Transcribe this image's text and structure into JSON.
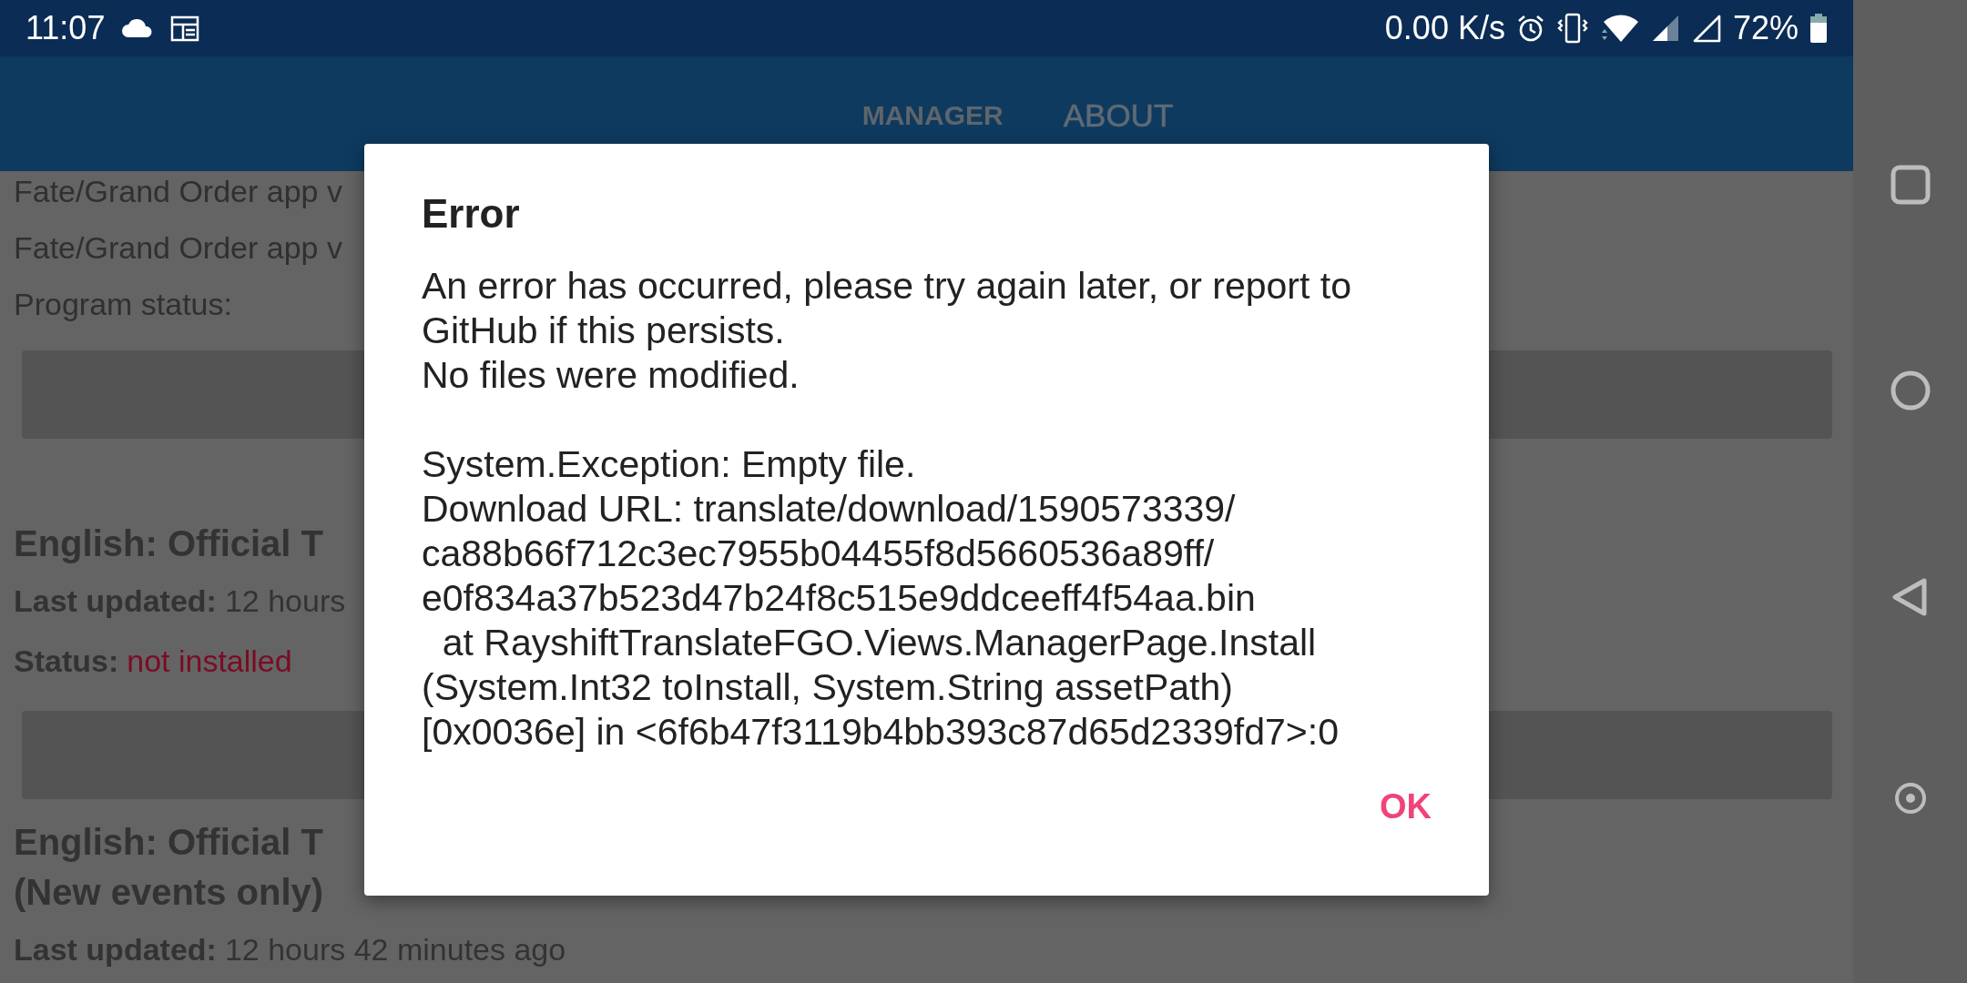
{
  "status_bar": {
    "time": "11:07",
    "speed": "0.00 K/s",
    "battery": "72%"
  },
  "tabs": [
    {
      "label": "MANAGER",
      "selected": true
    },
    {
      "label": "ABOUT",
      "selected": false
    }
  ],
  "content": [
    {
      "kind": "text",
      "text": "Fate/Grand Order app v"
    },
    {
      "kind": "text",
      "text": "Fate/Grand Order app v"
    },
    {
      "kind": "text",
      "text": "Program status:"
    },
    {
      "kind": "button"
    },
    {
      "kind": "heading",
      "text": "English: Official T"
    },
    {
      "kind": "field",
      "label": "Last updated:",
      "value": "12 hours"
    },
    {
      "kind": "status",
      "label": "Status:",
      "value": "not installed"
    },
    {
      "kind": "button"
    },
    {
      "kind": "heading",
      "text": "English: Official T\n(New events only)"
    },
    {
      "kind": "field",
      "label": "Last updated:",
      "value": "12 hours 42 minutes ago"
    }
  ],
  "dialog": {
    "title": "Error",
    "body": "An error has occurred, please try again later, or report to\nGitHub if this persists.\nNo files were modified.\n\nSystem.Exception: Empty file.\nDownload URL: translate/download/1590573339/\nca88b66f712c3ec7955b04455f8d5660536a89ff/\ne0f834a37b523d47b24f8c515e9ddceeff4f54aa.bin\n  at RayshiftTranslateFGO.Views.ManagerPage.Install\n(System.Int32 toInstall, System.String assetPath)\n[0x0036e] in <6f6b47f3119b4bb393c87d65d2339fd7>:0",
    "button": "OK"
  }
}
